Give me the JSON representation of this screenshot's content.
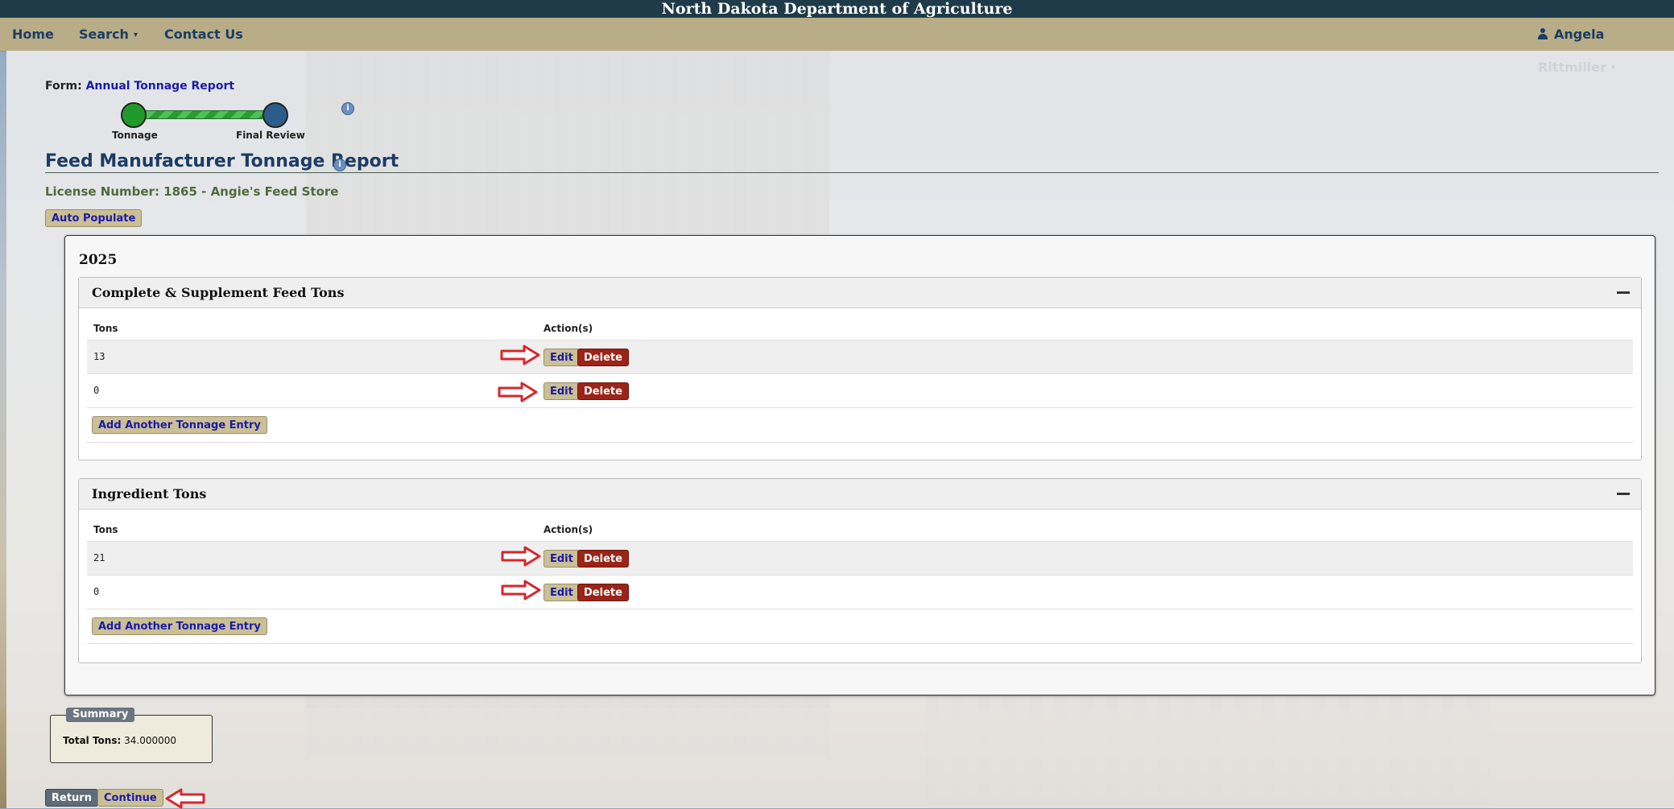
{
  "app": {
    "title": "North Dakota Department of Agriculture"
  },
  "nav": {
    "home": "Home",
    "search": "Search",
    "contact": "Contact Us",
    "user": "Angela Rittmiller"
  },
  "form": {
    "label": "Form:",
    "name": "Annual Tonnage Report",
    "steps": [
      "Tonnage",
      "Final Review"
    ],
    "info_icon": "i"
  },
  "page": {
    "title": "Feed Manufacturer Tonnage Report",
    "license": "License Number: 1865 - Angie's Feed Store",
    "auto_populate": "Auto Populate"
  },
  "year": {
    "label": "2025",
    "sections": [
      {
        "title": "Complete & Supplement Feed Tons",
        "columns": [
          "Tons",
          "Action(s)"
        ],
        "rows": [
          {
            "tons": "13",
            "edit": "Edit",
            "delete": "Delete"
          },
          {
            "tons": "0",
            "edit": "Edit",
            "delete": "Delete"
          }
        ],
        "add_button": "Add Another Tonnage Entry"
      },
      {
        "title": "Ingredient Tons",
        "columns": [
          "Tons",
          "Action(s)"
        ],
        "rows": [
          {
            "tons": "21",
            "edit": "Edit",
            "delete": "Delete"
          },
          {
            "tons": "0",
            "edit": "Edit",
            "delete": "Delete"
          }
        ],
        "add_button": "Add Another Tonnage Entry"
      }
    ]
  },
  "summary": {
    "legend": "Summary",
    "total_label": "Total Tons:",
    "total_value": "34.000000"
  },
  "footer": {
    "return": "Return",
    "continue": "Continue"
  },
  "colors": {
    "title_bar": "#1f3a49",
    "nav_bar": "#b8ad87",
    "link": "#1a1aa8",
    "delete": "#9b2418",
    "annotation_arrow": "#d7262e"
  }
}
